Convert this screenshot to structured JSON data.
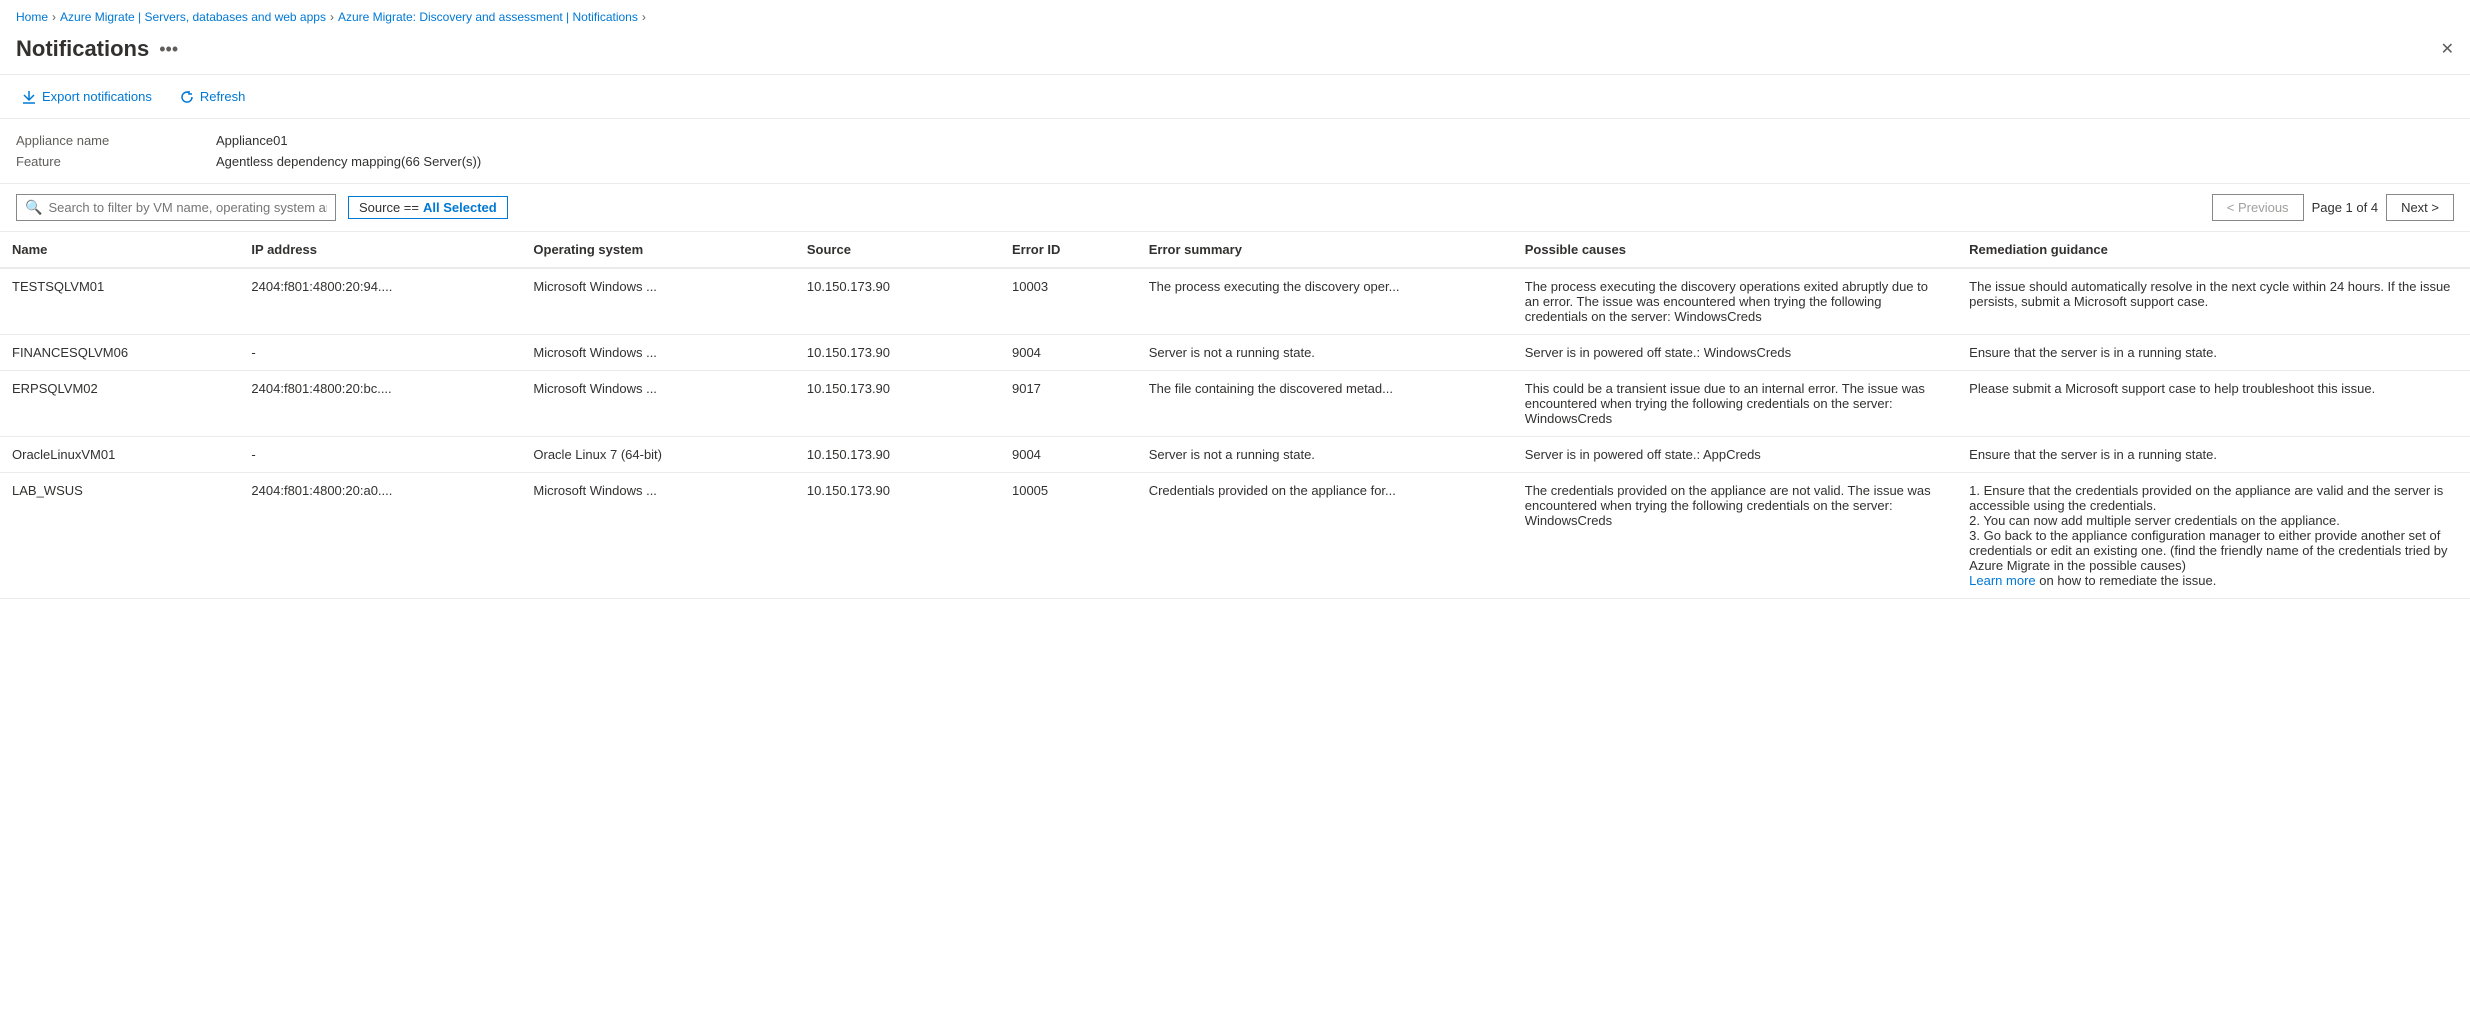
{
  "breadcrumb": {
    "items": [
      {
        "label": "Home",
        "href": true
      },
      {
        "label": "Azure Migrate | Servers, databases and web apps",
        "href": true
      },
      {
        "label": "Azure Migrate: Discovery and assessment | Notifications",
        "href": true
      }
    ],
    "current": "Notifications"
  },
  "header": {
    "title": "Notifications",
    "more_icon": "•••",
    "close_icon": "✕"
  },
  "toolbar": {
    "export_label": "Export notifications",
    "refresh_label": "Refresh"
  },
  "meta": {
    "appliance_label": "Appliance name",
    "appliance_value": "Appliance01",
    "feature_label": "Feature",
    "feature_value": "Agentless dependency mapping(66 Server(s))"
  },
  "filter": {
    "search_placeholder": "Search to filter by VM name, operating system and error ID",
    "filter_tag": "Source == All Selected"
  },
  "pagination": {
    "previous_label": "< Previous",
    "next_label": "Next >",
    "page_info": "Page 1 of 4"
  },
  "table": {
    "headers": [
      "Name",
      "IP address",
      "Operating system",
      "Source",
      "Error ID",
      "Error summary",
      "Possible causes",
      "Remediation guidance"
    ],
    "rows": [
      {
        "name": "TESTSQLVM01",
        "ip": "2404:f801:4800:20:94....",
        "os": "Microsoft Windows ...",
        "source": "10.150.173.90",
        "error_id": "10003",
        "error_summary": "The process executing the discovery oper...",
        "possible_causes": "The process executing the discovery operations exited abruptly due to an error. The issue was encountered when trying the following credentials on the server: WindowsCreds",
        "remediation": "The issue should automatically resolve in the next cycle within 24 hours. If the issue persists, submit a Microsoft support case.",
        "learn_more": null
      },
      {
        "name": "FINANCESQLVM06",
        "ip": "-",
        "os": "Microsoft Windows ...",
        "source": "10.150.173.90",
        "error_id": "9004",
        "error_summary": "Server is not a running state.",
        "possible_causes": "Server is in powered off state.: WindowsCreds",
        "remediation": "Ensure that the server is in a running state.",
        "learn_more": null
      },
      {
        "name": "ERPSQLVM02",
        "ip": "2404:f801:4800:20:bc....",
        "os": "Microsoft Windows ...",
        "source": "10.150.173.90",
        "error_id": "9017",
        "error_summary": "The file containing the discovered metad...",
        "possible_causes": "This could be a transient issue due to an internal error. The issue was encountered when trying the following credentials on the server: WindowsCreds",
        "remediation": "Please submit a Microsoft support case to help troubleshoot this issue.",
        "learn_more": null
      },
      {
        "name": "OracleLinuxVM01",
        "ip": "-",
        "os": "Oracle Linux 7 (64-bit)",
        "source": "10.150.173.90",
        "error_id": "9004",
        "error_summary": "Server is not a running state.",
        "possible_causes": "Server is in powered off state.: AppCreds",
        "remediation": "Ensure that the server is in a running state.",
        "learn_more": null
      },
      {
        "name": "LAB_WSUS",
        "ip": "2404:f801:4800:20:a0....",
        "os": "Microsoft Windows ...",
        "source": "10.150.173.90",
        "error_id": "10005",
        "error_summary": "Credentials provided on the appliance for...",
        "possible_causes": "The credentials provided on the appliance are not valid. The issue was encountered when trying the following credentials on the server: WindowsCreds",
        "remediation": "1. Ensure that the credentials provided on the appliance are valid and the server is accessible using the credentials.\n2. You can now add multiple server credentials on the appliance.\n3. Go back to the appliance configuration manager to either provide another set of credentials or edit an existing one. (find the friendly name of the credentials tried by Azure Migrate in the possible causes)",
        "learn_more": "Learn more",
        "learn_more_suffix": " on how to remediate the issue."
      }
    ]
  }
}
